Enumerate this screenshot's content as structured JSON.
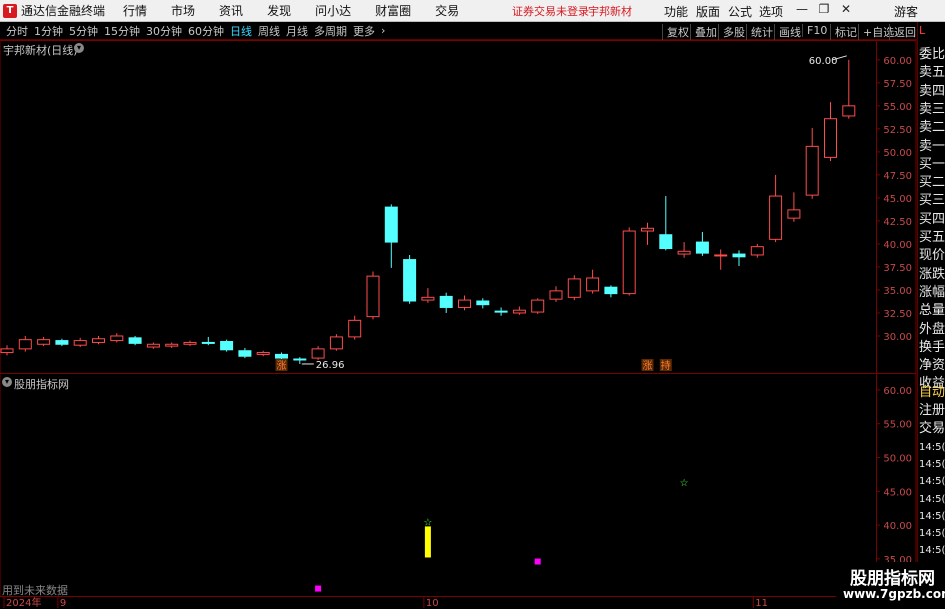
{
  "app": {
    "title": "通达信金融终端",
    "logo": "T"
  },
  "menu": [
    "行情",
    "市场",
    "资讯",
    "发现",
    "问小达",
    "财富圈",
    "交易"
  ],
  "status": {
    "login": "证券交易未登录",
    "stock_name": "宇邦新材"
  },
  "top_functions": [
    "功能",
    "版面",
    "公式",
    "选项",
    "游客"
  ],
  "window_controls": [
    "minimize-icon",
    "restore-icon",
    "close-icon"
  ],
  "window_glyphs": [
    "—",
    "❐",
    "✕"
  ],
  "periods": [
    {
      "label": "分时",
      "active": false
    },
    {
      "label": "1分钟",
      "active": false
    },
    {
      "label": "5分钟",
      "active": false
    },
    {
      "label": "15分钟",
      "active": false
    },
    {
      "label": "30分钟",
      "active": false
    },
    {
      "label": "60分钟",
      "active": false
    },
    {
      "label": "日线",
      "active": true
    },
    {
      "label": "周线",
      "active": false
    },
    {
      "label": "月线",
      "active": false
    },
    {
      "label": "多周期",
      "active": false
    },
    {
      "label": "更多",
      "active": false
    }
  ],
  "toolbar_right": [
    "复权",
    "叠加",
    "多股",
    "统计",
    "画线",
    "F10",
    "标记",
    "+自选",
    "返回"
  ],
  "main_chart": {
    "title": "宇邦新材(日线)",
    "y_ticks": [
      "60.00",
      "57.50",
      "55.00",
      "52.50",
      "50.00",
      "47.50",
      "45.00",
      "42.50",
      "40.00",
      "37.50",
      "35.00",
      "32.50",
      "30.00"
    ],
    "y_range": [
      27.5,
      61.5
    ],
    "high_label": "60.00",
    "low_label": "26.96",
    "markers": [
      "涨",
      "涨",
      "持"
    ],
    "candles": [
      {
        "o": 28.2,
        "c": 28.6,
        "h": 29.0,
        "l": 27.9
      },
      {
        "o": 28.6,
        "c": 29.6,
        "h": 30.0,
        "l": 28.3
      },
      {
        "o": 29.1,
        "c": 29.6,
        "h": 29.9,
        "l": 28.9
      },
      {
        "o": 29.5,
        "c": 29.1,
        "h": 29.7,
        "l": 28.9
      },
      {
        "o": 29.0,
        "c": 29.5,
        "h": 29.8,
        "l": 28.8
      },
      {
        "o": 29.3,
        "c": 29.7,
        "h": 30.0,
        "l": 29.1
      },
      {
        "o": 29.5,
        "c": 30.0,
        "h": 30.3,
        "l": 29.3
      },
      {
        "o": 29.8,
        "c": 29.2,
        "h": 30.0,
        "l": 29.0
      },
      {
        "o": 28.8,
        "c": 29.1,
        "h": 29.3,
        "l": 28.6
      },
      {
        "o": 28.9,
        "c": 29.1,
        "h": 29.3,
        "l": 28.7
      },
      {
        "o": 29.1,
        "c": 29.3,
        "h": 29.5,
        "l": 28.9
      },
      {
        "o": 29.3,
        "c": 29.2,
        "h": 29.9,
        "l": 29.0
      },
      {
        "o": 29.4,
        "c": 28.5,
        "h": 29.6,
        "l": 28.3
      },
      {
        "o": 28.4,
        "c": 27.8,
        "h": 28.7,
        "l": 27.6
      },
      {
        "o": 28.0,
        "c": 28.2,
        "h": 28.4,
        "l": 27.8
      },
      {
        "o": 28.0,
        "c": 27.6,
        "h": 28.2,
        "l": 27.3
      },
      {
        "o": 27.5,
        "c": 27.4,
        "h": 27.7,
        "l": 26.96
      },
      {
        "o": 27.6,
        "c": 28.6,
        "h": 28.9,
        "l": 27.4
      },
      {
        "o": 28.6,
        "c": 29.9,
        "h": 30.2,
        "l": 28.4
      },
      {
        "o": 29.9,
        "c": 31.7,
        "h": 32.2,
        "l": 29.6
      },
      {
        "o": 32.1,
        "c": 36.5,
        "h": 37.0,
        "l": 31.8
      },
      {
        "o": 44.0,
        "c": 40.2,
        "h": 44.3,
        "l": 37.4
      },
      {
        "o": 38.3,
        "c": 33.8,
        "h": 38.8,
        "l": 33.5
      },
      {
        "o": 33.9,
        "c": 34.2,
        "h": 35.2,
        "l": 33.6
      },
      {
        "o": 34.3,
        "c": 33.1,
        "h": 34.7,
        "l": 32.5
      },
      {
        "o": 33.1,
        "c": 33.9,
        "h": 34.4,
        "l": 32.8
      },
      {
        "o": 33.8,
        "c": 33.4,
        "h": 34.1,
        "l": 33.0
      },
      {
        "o": 32.7,
        "c": 32.6,
        "h": 33.1,
        "l": 32.2
      },
      {
        "o": 32.5,
        "c": 32.8,
        "h": 33.2,
        "l": 32.3
      },
      {
        "o": 32.6,
        "c": 33.9,
        "h": 34.1,
        "l": 32.4
      },
      {
        "o": 34.0,
        "c": 34.9,
        "h": 35.4,
        "l": 33.7
      },
      {
        "o": 34.2,
        "c": 36.2,
        "h": 36.6,
        "l": 33.9
      },
      {
        "o": 34.9,
        "c": 36.3,
        "h": 37.2,
        "l": 34.6
      },
      {
        "o": 35.3,
        "c": 34.6,
        "h": 35.5,
        "l": 34.2
      },
      {
        "o": 34.6,
        "c": 41.4,
        "h": 41.8,
        "l": 34.4
      },
      {
        "o": 41.4,
        "c": 41.7,
        "h": 42.3,
        "l": 39.9
      },
      {
        "o": 41.0,
        "c": 39.5,
        "h": 45.2,
        "l": 39.3
      },
      {
        "o": 38.9,
        "c": 39.2,
        "h": 40.2,
        "l": 38.5
      },
      {
        "o": 40.2,
        "c": 39.0,
        "h": 41.3,
        "l": 38.7
      },
      {
        "o": 38.8,
        "c": 38.8,
        "h": 39.4,
        "l": 37.2
      },
      {
        "o": 38.9,
        "c": 38.6,
        "h": 39.3,
        "l": 37.6
      },
      {
        "o": 38.8,
        "c": 39.7,
        "h": 40.0,
        "l": 38.5
      },
      {
        "o": 40.5,
        "c": 45.2,
        "h": 47.5,
        "l": 40.2
      },
      {
        "o": 42.8,
        "c": 43.7,
        "h": 45.6,
        "l": 42.4
      },
      {
        "o": 45.3,
        "c": 50.6,
        "h": 52.6,
        "l": 44.9
      },
      {
        "o": 49.4,
        "c": 53.6,
        "h": 55.4,
        "l": 49.0
      },
      {
        "o": 53.9,
        "c": 55.0,
        "h": 60.0,
        "l": 53.6
      }
    ]
  },
  "indicator_chart": {
    "title": "股朋指标网",
    "y_ticks": [
      "60.00",
      "55.00",
      "50.00",
      "45.00",
      "40.00",
      "35.00"
    ],
    "y_range": [
      29.5,
      62.5
    ],
    "yellow_bar": {
      "index": 23,
      "from": 35.2,
      "to": 39.8
    },
    "stars": [
      {
        "index": 23,
        "value": 40.5
      },
      {
        "index": 37,
        "value": 46.4
      }
    ],
    "squares": [
      {
        "index": 29,
        "value": 34.6
      },
      {
        "index": 17,
        "value": 30.6
      }
    ]
  },
  "x_axis": {
    "labels": [
      {
        "text": "2024年",
        "index": 0
      },
      {
        "text": "9",
        "index": 3
      },
      {
        "text": "10",
        "index": 23
      },
      {
        "text": "11",
        "index": 41
      }
    ]
  },
  "footer_note": "用到未来数据",
  "right_panel": {
    "top": "L",
    "items": [
      "委比",
      "卖五",
      "卖四",
      "卖三",
      "卖二",
      "卖一",
      "买一",
      "买二",
      "买三",
      "买四",
      "买五",
      "现价",
      "涨跌",
      "涨幅",
      "总量",
      "外盘",
      "换手",
      "净资",
      "收益"
    ],
    "auto": "自动",
    "extra": [
      "注册",
      "交易"
    ],
    "times": [
      "14:5(",
      "14:5(",
      "14:5(",
      "14:5(",
      "14:5(",
      "14:5(",
      "14:5(",
      "14:5("
    ]
  },
  "watermark": {
    "line1": "股朋指标网",
    "line2": "www.7gpzb.com"
  },
  "colors": {
    "up": "#ff4c4c",
    "down": "#54ffff",
    "grid_red": "#7a0000",
    "text": "#c8c8c8",
    "yellow": "#ffff00",
    "magenta": "#ff00ff",
    "green": "#40ff40"
  }
}
